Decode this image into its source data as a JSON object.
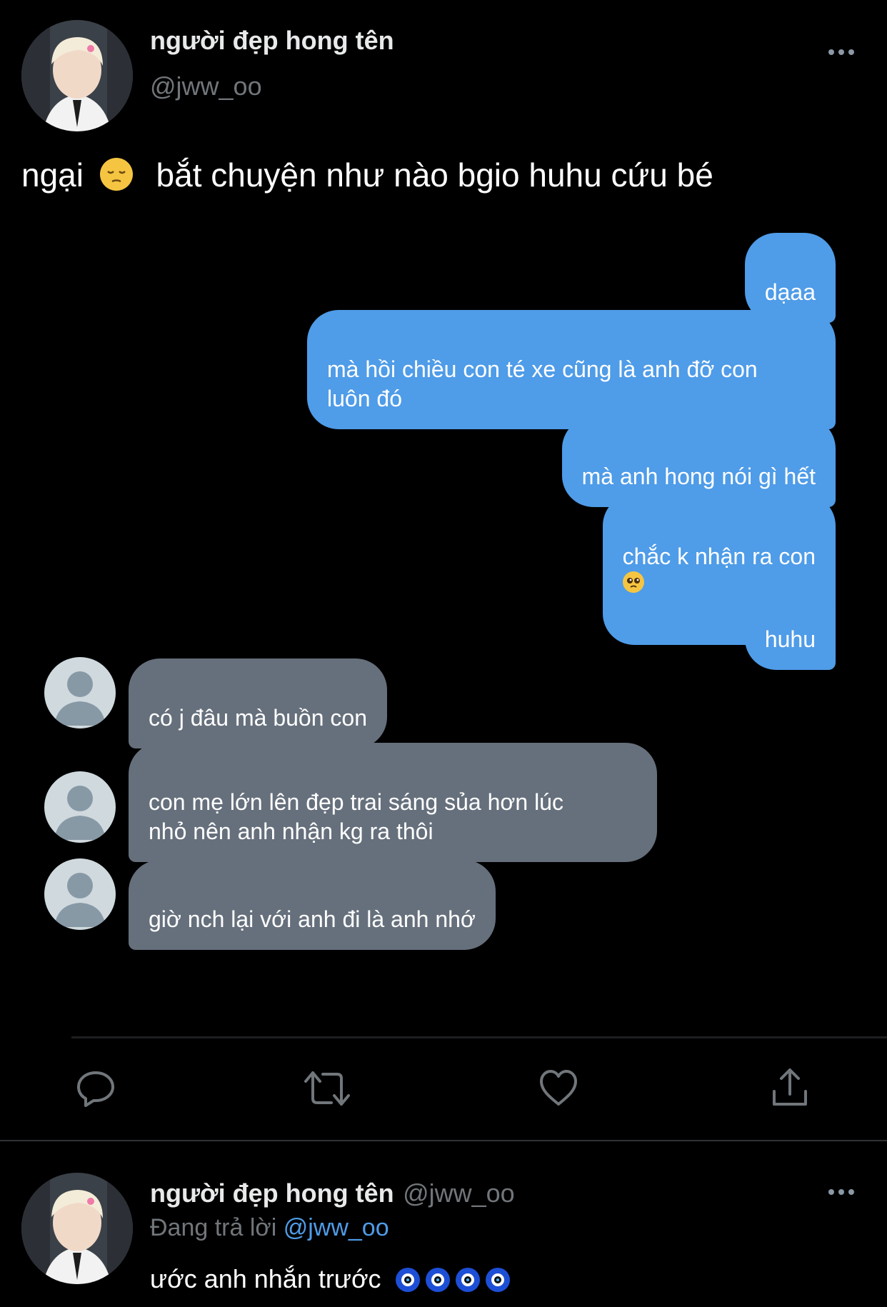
{
  "tweet": {
    "author_name": "người đẹp hong tên",
    "author_handle": "@jww_oo",
    "text_before_emoji": "ngại",
    "text_emoji": "pensive-face",
    "text_after_emoji": "bắt chuyện như nào bgio huhu cứu bé"
  },
  "screenshot_chat": {
    "sent_messages": [
      {
        "text": "dạaa"
      },
      {
        "text": "mà hồi chiều con té xe cũng là anh đỡ con\nluôn đó"
      },
      {
        "text": "mà anh hong nói gì hết"
      },
      {
        "text": "chắc k nhận ra con",
        "emoji": "pleading-face"
      },
      {
        "text": "huhu"
      }
    ],
    "received_messages": [
      {
        "text": "có j đâu mà buồn con"
      },
      {
        "text": "con mẹ lớn lên đẹp trai sáng sủa hơn lúc\nnhỏ nên anh nhận kg ra thôi"
      },
      {
        "text": "giờ nch lại với anh đi là anh nhớ"
      }
    ],
    "colors": {
      "sent": "#4f9ce8",
      "received": "#66707c"
    }
  },
  "actions": {
    "icons": [
      "reply-icon",
      "retweet-icon",
      "like-icon",
      "share-icon"
    ]
  },
  "reply": {
    "author_name": "người đẹp hong tên",
    "author_handle": "@jww_oo",
    "replying_prefix": "Đang trả lời",
    "replying_to": "@jww_oo",
    "text": "ước anh nhắn trước",
    "emoji": "nazar-amulet"
  }
}
